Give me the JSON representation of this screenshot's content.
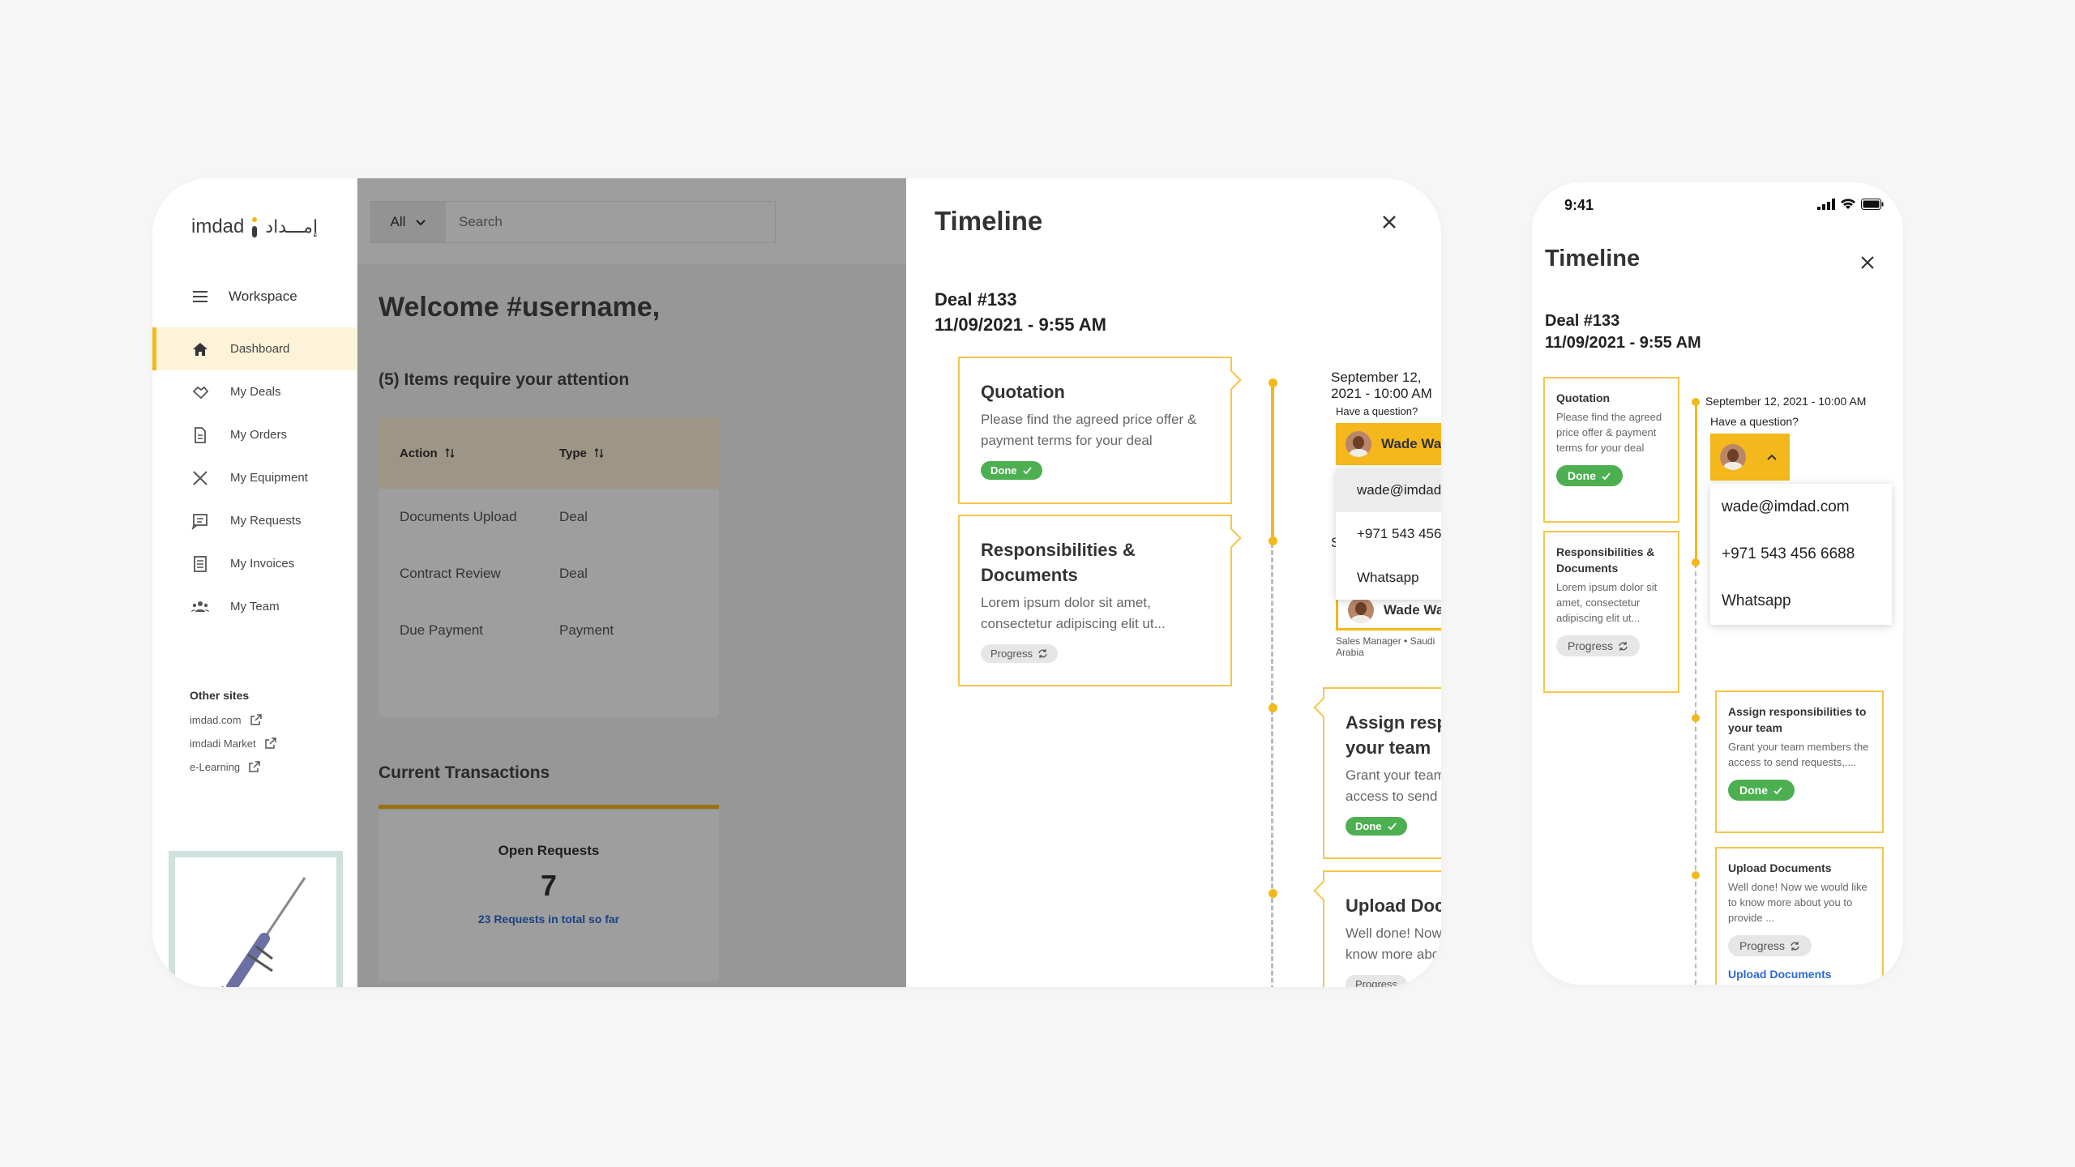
{
  "sidebar": {
    "logo_en": "imdad",
    "logo_ar": "إمـــداد",
    "workspace": "Workspace",
    "items": [
      {
        "label": "Dashboard",
        "icon": "home-icon",
        "active": true
      },
      {
        "label": "My Deals",
        "icon": "handshake-icon"
      },
      {
        "label": "My Orders",
        "icon": "document-icon"
      },
      {
        "label": "My Equipment",
        "icon": "tools-icon"
      },
      {
        "label": "My Requests",
        "icon": "requests-icon"
      },
      {
        "label": "My Invoices",
        "icon": "invoice-icon"
      },
      {
        "label": "My Team",
        "icon": "team-icon"
      }
    ],
    "other_sites_title": "Other sites",
    "other_sites": [
      "imdad.com",
      "imdadi Market",
      "e-Learning"
    ]
  },
  "topbar": {
    "filter": "All",
    "search_placeholder": "Search"
  },
  "dashboard": {
    "welcome": "Welcome #username,",
    "attention": "(5) Items require your attention",
    "table_headers": [
      "Action",
      "Type"
    ],
    "rows": [
      [
        "Documents Upload",
        "Deal"
      ],
      [
        "Contract Review",
        "Deal"
      ],
      [
        "Due Payment",
        "Payment"
      ]
    ],
    "current_title": "Current Transactions",
    "open_requests_title": "Open Requests",
    "open_requests_count": "7",
    "open_requests_link": "23 Requests in total so far"
  },
  "timeline": {
    "title": "Timeline",
    "deal_number": "Deal #133",
    "deal_date": "11/09/2021 - 9:55 AM",
    "cards": {
      "quotation": {
        "title": "Quotation",
        "desc": "Please find the agreed price offer & payment terms for your deal",
        "status": "Done"
      },
      "responsibilities": {
        "title": "Responsibilities & Documents",
        "desc": "Lorem ipsum dolor sit amet, consectetur adipiscing elit ut...",
        "status": "Progress"
      },
      "assign": {
        "title": "Assign responsibilities to your team",
        "desc": "Grant your team members the access to send requests,....",
        "status": "Done"
      },
      "upload": {
        "title": "Upload Documents",
        "desc": "Well done! Now we would like to know more about you to provide ...",
        "status": "Progress"
      }
    },
    "event_date": "September 12, 2021 - 10:00 AM",
    "question": "Have a question?",
    "contact_name": "Wade Warren",
    "contact_role": "Sales Manager • Saudi Arabia",
    "contact_options": [
      "wade@imdad.com",
      "+971 543 456 6688",
      "Whatsapp"
    ],
    "partial_date_prefix": "S",
    "partial_date_suffix": "AM"
  },
  "mobile": {
    "time": "9:41",
    "upload_link": "Upload Documents"
  },
  "colors": {
    "accent": "#f2b91c",
    "done": "#4caf50",
    "link": "#2a6ad6"
  }
}
